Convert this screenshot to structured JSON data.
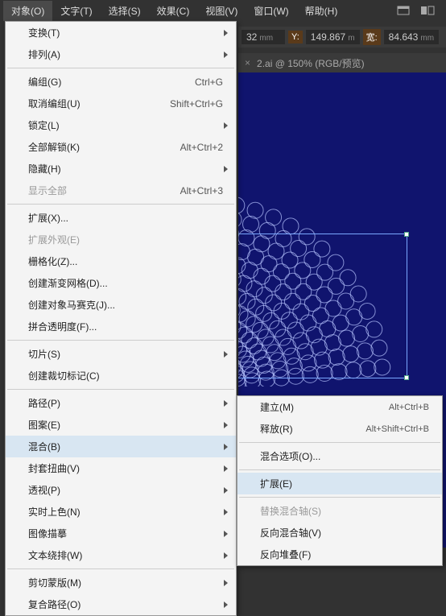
{
  "menubar": {
    "items": [
      "对象(O)",
      "文字(T)",
      "选择(S)",
      "效果(C)",
      "视图(V)",
      "窗口(W)",
      "帮助(H)"
    ],
    "active_index": 0
  },
  "coords": {
    "x_val": "32",
    "x_unit": "mm",
    "y_label": "Y:",
    "y_val": "149.867",
    "y_unit": "m",
    "w_label": "宽:",
    "w_val": "84.643",
    "w_unit": "mm"
  },
  "tab": {
    "close": "×",
    "title": "2.ai @ 150% (RGB/预览)"
  },
  "menu": {
    "items": [
      {
        "label": "变换(T)",
        "sub": true
      },
      {
        "label": "排列(A)",
        "sub": true
      },
      {
        "sep": true
      },
      {
        "label": "编组(G)",
        "short": "Ctrl+G"
      },
      {
        "label": "取消编组(U)",
        "short": "Shift+Ctrl+G"
      },
      {
        "label": "锁定(L)",
        "sub": true
      },
      {
        "label": "全部解锁(K)",
        "short": "Alt+Ctrl+2"
      },
      {
        "label": "隐藏(H)",
        "sub": true
      },
      {
        "label": "显示全部",
        "short": "Alt+Ctrl+3",
        "disabled": true
      },
      {
        "sep": true
      },
      {
        "label": "扩展(X)..."
      },
      {
        "label": "扩展外观(E)",
        "disabled": true
      },
      {
        "label": "栅格化(Z)..."
      },
      {
        "label": "创建渐变网格(D)..."
      },
      {
        "label": "创建对象马赛克(J)..."
      },
      {
        "label": "拼合透明度(F)..."
      },
      {
        "sep": true
      },
      {
        "label": "切片(S)",
        "sub": true
      },
      {
        "label": "创建裁切标记(C)"
      },
      {
        "sep": true
      },
      {
        "label": "路径(P)",
        "sub": true
      },
      {
        "label": "图案(E)",
        "sub": true
      },
      {
        "label": "混合(B)",
        "sub": true,
        "hover": true
      },
      {
        "label": "封套扭曲(V)",
        "sub": true
      },
      {
        "label": "透视(P)",
        "sub": true
      },
      {
        "label": "实时上色(N)",
        "sub": true
      },
      {
        "label": "图像描摹",
        "sub": true
      },
      {
        "label": "文本绕排(W)",
        "sub": true
      },
      {
        "sep": true
      },
      {
        "label": "剪切蒙版(M)",
        "sub": true
      },
      {
        "label": "复合路径(O)",
        "sub": true
      }
    ]
  },
  "submenu": {
    "items": [
      {
        "label": "建立(M)",
        "short": "Alt+Ctrl+B"
      },
      {
        "label": "释放(R)",
        "short": "Alt+Shift+Ctrl+B"
      },
      {
        "sep": true
      },
      {
        "label": "混合选项(O)..."
      },
      {
        "sep": true
      },
      {
        "label": "扩展(E)",
        "hover": true
      },
      {
        "sep": true
      },
      {
        "label": "替换混合轴(S)",
        "disabled": true
      },
      {
        "label": "反向混合轴(V)"
      },
      {
        "label": "反向堆叠(F)"
      }
    ]
  }
}
